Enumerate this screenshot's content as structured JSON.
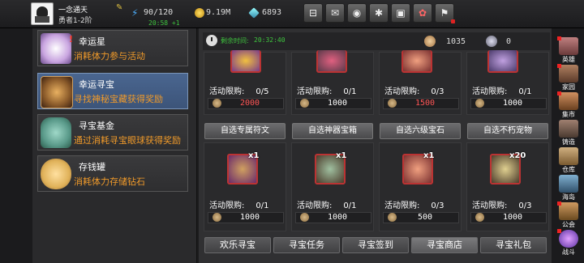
{
  "player": {
    "name": "一念通天",
    "title": "勇者1-2阶",
    "timer": "20:58 +1"
  },
  "resources": {
    "stamina": "90/120",
    "gold": "9.19M",
    "gems": "6893"
  },
  "top_buttons": [
    "cart-icon",
    "mail-icon",
    "gamepad-icon",
    "gear-icon",
    "gift-icon",
    "wheel-icon",
    "flag-icon"
  ],
  "left_menu": [
    {
      "title": "幸运星",
      "desc": "消耗体力参与活动",
      "color": "#c9a5e0"
    },
    {
      "title": "幸运寻宝",
      "desc": "寻找神秘宝藏获得奖励",
      "color": "#8a5a2a"
    },
    {
      "title": "寻宝基金",
      "desc": "通过消耗寻宝眼球获得奖励",
      "color": "#5a9a8a"
    },
    {
      "title": "存钱罐",
      "desc": "消耗体力存储钻石",
      "color": "#e0b25a"
    }
  ],
  "header": {
    "remaining_label": "剩余时间:",
    "remaining_time": "20:32:40",
    "currency1": "1035",
    "currency2": "0"
  },
  "row1": [
    {
      "limit_label": "活动限购:",
      "limit": "0/5",
      "price": "2000",
      "price_color": "#ff5555"
    },
    {
      "limit_label": "活动限购:",
      "limit": "0/1",
      "price": "1000",
      "price_color": "#ffffff"
    },
    {
      "limit_label": "活动限购:",
      "limit": "0/3",
      "price": "1500",
      "price_color": "#ff5555"
    },
    {
      "limit_label": "活动限购:",
      "limit": "0/1",
      "price": "1000",
      "price_color": "#ffffff"
    }
  ],
  "categories": [
    "自选专属符文",
    "自选神器宝箱",
    "自选六级宝石",
    "自选不朽宠物"
  ],
  "row2": [
    {
      "qty": "x1",
      "limit_label": "活动限购:",
      "limit": "0/1",
      "price": "1000"
    },
    {
      "qty": "x1",
      "limit_label": "活动限购:",
      "limit": "0/1",
      "price": "1000"
    },
    {
      "qty": "x1",
      "limit_label": "活动限购:",
      "limit": "0/3",
      "price": "500"
    },
    {
      "qty": "x20",
      "limit_label": "活动限购:",
      "limit": "0/3",
      "price": "1000"
    }
  ],
  "tabs": [
    "欢乐寻宝",
    "寻宝任务",
    "寻宝签到",
    "寻宝商店",
    "寻宝礼包"
  ],
  "selected_tab": "寻宝商店",
  "right_rail": [
    {
      "label": "英雄",
      "color": "#b87070"
    },
    {
      "label": "家园",
      "color": "#a07050"
    },
    {
      "label": "集市",
      "color": "#c08050"
    },
    {
      "label": "铸造",
      "color": "#907060"
    },
    {
      "label": "仓库",
      "color": "#c0a070"
    },
    {
      "label": "海岛",
      "color": "#6090b0"
    },
    {
      "label": "公会",
      "color": "#b08050"
    },
    {
      "label": "战斗",
      "color": "#8060c0"
    }
  ]
}
